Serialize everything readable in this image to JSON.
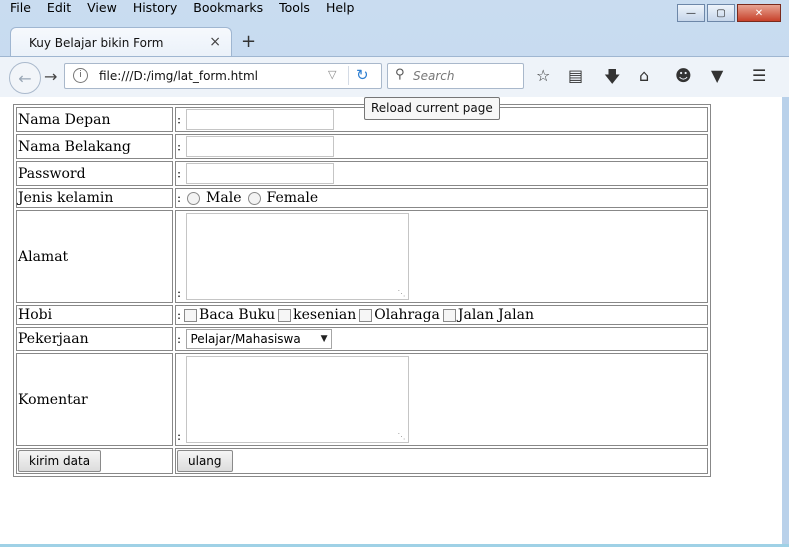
{
  "menu": [
    "File",
    "Edit",
    "View",
    "History",
    "Bookmarks",
    "Tools",
    "Help"
  ],
  "window": {
    "min": "—",
    "max": "▢",
    "close": "✕"
  },
  "tab": {
    "title": "Kuy Belajar bikin Form",
    "close": "×",
    "new_tab": "+"
  },
  "nav": {
    "url": "file:///D:/img/lat_form.html",
    "search_placeholder": "Search",
    "tooltip": "Reload current page"
  },
  "form": {
    "first_name_label": "Nama Depan",
    "last_name_label": "Nama Belakang",
    "password_label": "Password",
    "gender_label": "Jenis kelamin",
    "gender_options": [
      "Male",
      "Female"
    ],
    "address_label": "Alamat",
    "hobby_label": "Hobi",
    "hobbies": [
      "Baca Buku",
      "kesenian",
      "Olahraga",
      "Jalan Jalan"
    ],
    "job_label": "Pekerjaan",
    "job_selected": "Pelajar/Mahasiswa",
    "comment_label": "Komentar",
    "colon": ":",
    "submit_label": "kirim data",
    "reset_label": "ulang"
  }
}
